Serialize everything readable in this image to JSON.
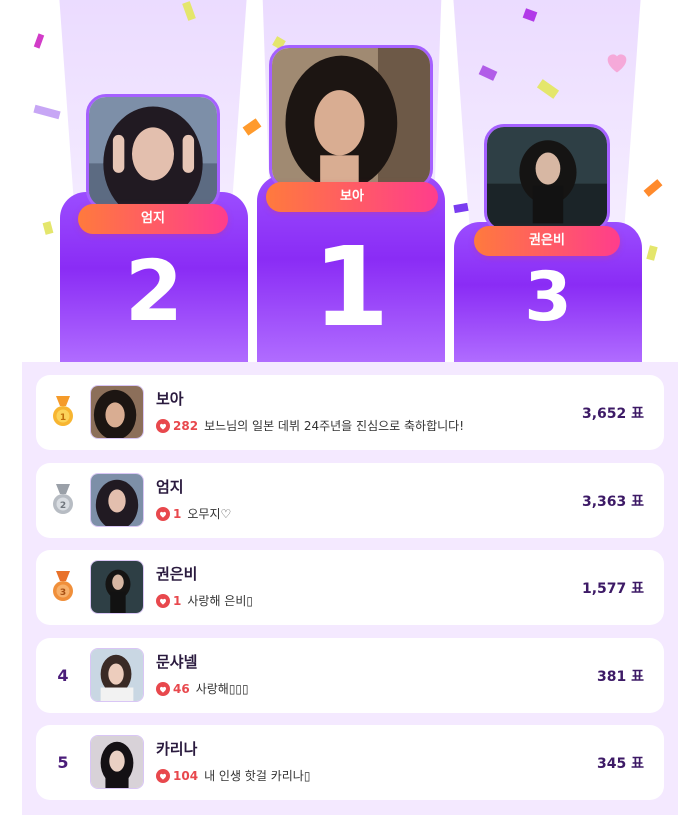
{
  "podium": [
    {
      "rank": "1",
      "name": "보아"
    },
    {
      "rank": "2",
      "name": "엄지"
    },
    {
      "rank": "3",
      "name": "권은비"
    }
  ],
  "ranking": [
    {
      "rank": "1",
      "medal": "gold-medal-icon",
      "name": "보아",
      "likes": "282",
      "message": "보느님의 일본 데뷔 24주년을 진심으로 축하합니다!",
      "votes": "3,652 표"
    },
    {
      "rank": "2",
      "medal": "silver-medal-icon",
      "name": "엄지",
      "likes": "1",
      "message": "오무지♡",
      "votes": "3,363 표"
    },
    {
      "rank": "3",
      "medal": "bronze-medal-icon",
      "name": "권은비",
      "likes": "1",
      "message": "사랑해 은비▯",
      "votes": "1,577 표"
    },
    {
      "rank": "4",
      "name": "문샤넬",
      "likes": "46",
      "message": "사랑해▯▯▯",
      "votes": "381 표"
    },
    {
      "rank": "5",
      "name": "카리나",
      "likes": "104",
      "message": "내 인생 핫걸 카리나▯",
      "votes": "345 표"
    }
  ],
  "colors": {
    "podium_purple": "#8a2cf5",
    "pill_start": "#ff7a3d",
    "pill_end": "#ff3d8c",
    "list_bg": "#f4e9ff",
    "like_red": "#e8484d",
    "vote_text": "#3d1a66"
  }
}
